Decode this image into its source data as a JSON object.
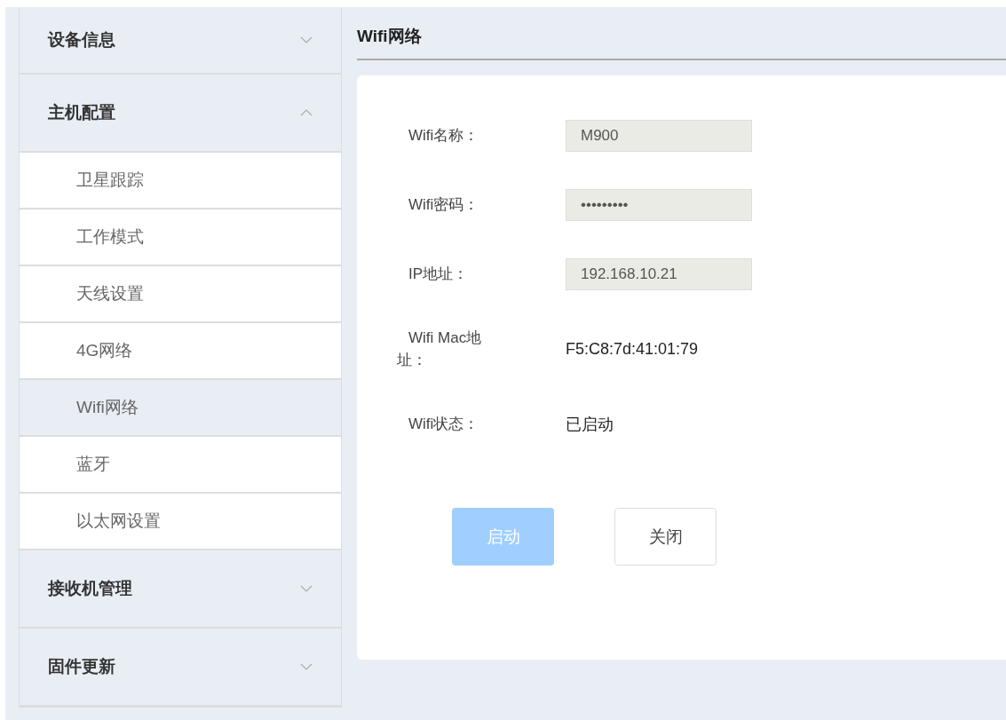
{
  "sidebar": {
    "groups": [
      {
        "label": "设备信息",
        "expanded": false
      },
      {
        "label": "主机配置",
        "expanded": true,
        "children": [
          {
            "label": "卫星跟踪",
            "selected": false
          },
          {
            "label": "工作模式",
            "selected": false
          },
          {
            "label": "天线设置",
            "selected": false
          },
          {
            "label": "4G网络",
            "selected": false
          },
          {
            "label": "Wifi网络",
            "selected": true
          },
          {
            "label": "蓝牙",
            "selected": false
          },
          {
            "label": "以太网设置",
            "selected": false
          }
        ]
      },
      {
        "label": "接收机管理",
        "expanded": false
      },
      {
        "label": "固件更新",
        "expanded": false
      }
    ]
  },
  "page": {
    "title": "Wifi网络"
  },
  "form": {
    "fields": [
      {
        "label": "Wifi名称：",
        "kind": "input",
        "value": "M900"
      },
      {
        "label": "Wifi密码：",
        "kind": "input",
        "value": "•••••••••"
      },
      {
        "label": "IP地址：",
        "kind": "input",
        "value": "192.168.10.21"
      },
      {
        "label": "Wifi Mac地址：",
        "kind": "text",
        "value": "F5:C8:7d:41:01:79"
      },
      {
        "label": "Wifi状态：",
        "kind": "text",
        "value": "已启动"
      }
    ],
    "buttons": [
      {
        "label": "启动",
        "kind": "primary",
        "disabled": true
      },
      {
        "label": "关闭",
        "kind": "default",
        "disabled": false
      }
    ]
  }
}
